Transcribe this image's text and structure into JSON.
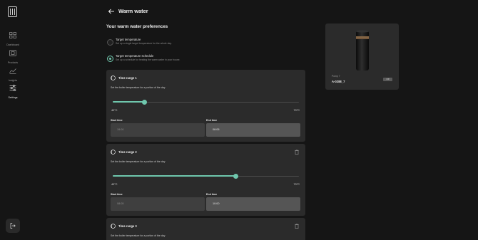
{
  "sidebar": {
    "items": [
      {
        "label": "Dashboard",
        "icon": "dashboard-icon",
        "active": false
      },
      {
        "label": "Products",
        "icon": "products-icon",
        "active": false
      },
      {
        "label": "Insights",
        "icon": "insights-icon",
        "active": false
      },
      {
        "label": "Settings",
        "icon": "settings-icon",
        "active": true
      }
    ]
  },
  "header": {
    "title": "Warm water"
  },
  "preferences": {
    "title": "Your warm water preferences",
    "options": [
      {
        "title": "Target temperature",
        "description": "Set up a single target temperature for the whole day.",
        "selected": false
      },
      {
        "title": "Target temperature schedule",
        "description": "Set up a schedule for heating the warm water in your house.",
        "selected": true
      }
    ]
  },
  "ranges": [
    {
      "title": "Time range 1",
      "description": "Set the boiler temperature for a portion of the day",
      "min_label": "40°C",
      "max_label": "70°C",
      "level": 0.17,
      "start_label": "Start time",
      "start_value": "19:00",
      "end_label": "End time",
      "end_value": "08:05",
      "deletable": false
    },
    {
      "title": "Time range 2",
      "description": "Set the boiler temperature for a portion of the day",
      "min_label": "40°C",
      "max_label": "70°C",
      "level": 0.66,
      "start_label": "Start time",
      "start_value": "08:05",
      "end_label": "End time",
      "end_value": "10:00",
      "deletable": true
    },
    {
      "title": "Time range 3",
      "description": "Set the boiler temperature for a portion of the day",
      "deletable": true
    }
  ],
  "device": {
    "name": "Pomp 7",
    "id": "A-0288_7",
    "status": "Off"
  },
  "colors": {
    "accent": "#6fc7ad",
    "background": "#151515",
    "card": "#2b2b2b"
  }
}
